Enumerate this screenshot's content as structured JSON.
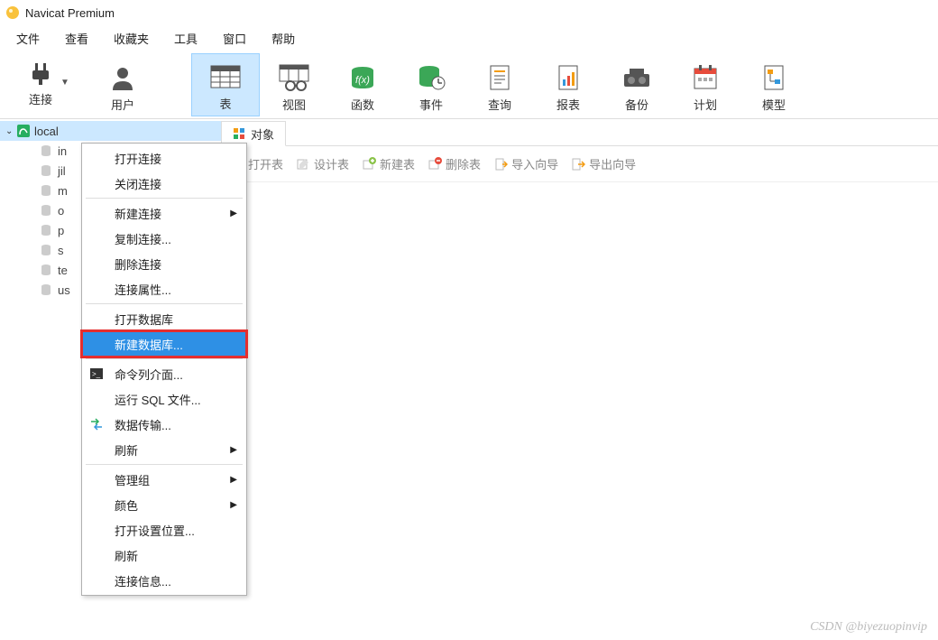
{
  "app": {
    "title": "Navicat Premium"
  },
  "menubar": [
    "文件",
    "查看",
    "收藏夹",
    "工具",
    "窗口",
    "帮助"
  ],
  "toolbar": [
    {
      "name": "connection",
      "label": "连接",
      "has_dropdown": true
    },
    {
      "name": "user",
      "label": "用户"
    },
    {
      "name": "table",
      "label": "表",
      "selected": true
    },
    {
      "name": "view",
      "label": "视图"
    },
    {
      "name": "function",
      "label": "函数"
    },
    {
      "name": "event",
      "label": "事件"
    },
    {
      "name": "query",
      "label": "查询"
    },
    {
      "name": "report",
      "label": "报表"
    },
    {
      "name": "backup",
      "label": "备份"
    },
    {
      "name": "schedule",
      "label": "计划"
    },
    {
      "name": "model",
      "label": "模型"
    }
  ],
  "sidebar": {
    "root_label": "local",
    "items": [
      "in",
      "jil",
      "m",
      "o",
      "p",
      "s",
      "te",
      "us"
    ]
  },
  "tabs": {
    "active": "对象"
  },
  "actions": [
    "打开表",
    "设计表",
    "新建表",
    "删除表",
    "导入向导",
    "导出向导"
  ],
  "context_menu": [
    {
      "label": "打开连接"
    },
    {
      "label": "关闭连接"
    },
    {
      "sep": true
    },
    {
      "label": "新建连接",
      "submenu": true
    },
    {
      "label": "复制连接..."
    },
    {
      "label": "删除连接"
    },
    {
      "label": "连接属性..."
    },
    {
      "sep": true
    },
    {
      "label": "打开数据库"
    },
    {
      "label": "新建数据库...",
      "hover": true,
      "highlight": true
    },
    {
      "sep": true
    },
    {
      "label": "命令列介面...",
      "icon": "cmd"
    },
    {
      "label": "运行 SQL 文件..."
    },
    {
      "label": "数据传输...",
      "icon": "transfer"
    },
    {
      "label": "刷新",
      "submenu": true
    },
    {
      "sep": true
    },
    {
      "label": "管理组",
      "submenu": true
    },
    {
      "label": "颜色",
      "submenu": true
    },
    {
      "label": "打开设置位置..."
    },
    {
      "label": "刷新"
    },
    {
      "label": "连接信息..."
    }
  ],
  "watermark": "CSDN @biyezuopinvip"
}
